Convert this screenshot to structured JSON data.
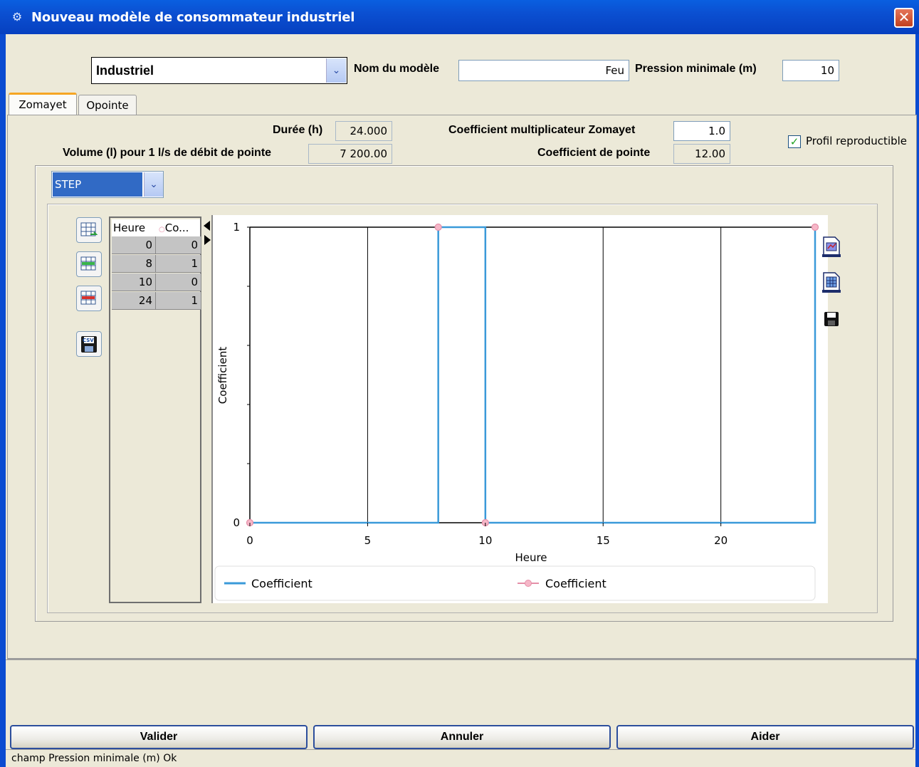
{
  "window": {
    "title": "Nouveau modèle de consommateur industriel",
    "close_label": "✕"
  },
  "header": {
    "type_selected": "Industriel",
    "model_name_label": "Nom du modèle",
    "model_name_value": "Feu",
    "min_pressure_label": "Pression minimale (m)",
    "min_pressure_value": "10"
  },
  "tabs": [
    {
      "label": "Zomayet",
      "active": true
    },
    {
      "label": "Opointe",
      "active": false
    }
  ],
  "params": {
    "duration_label": "Durée (h)",
    "duration_value": "24.000",
    "volume_label": "Volume (l) pour 1 l/s de débit de pointe",
    "volume_value": "7 200.00",
    "multiplier_label": "Coefficient multiplicateur Zomayet",
    "multiplier_value": "1.0",
    "peak_coef_label": "Coefficient de pointe",
    "peak_coef_value": "12.00",
    "reproducible_label": "Profil reproductible",
    "reproducible_checked": true
  },
  "curve_type": "STEP",
  "table": {
    "headers": [
      "Heure",
      "Co..."
    ],
    "rows": [
      [
        "0",
        "0"
      ],
      [
        "8",
        "1"
      ],
      [
        "10",
        "0"
      ],
      [
        "24",
        "1"
      ]
    ]
  },
  "chart_data": {
    "type": "line",
    "step": true,
    "xlabel": "Heure",
    "ylabel": "Coefficient",
    "xlim": [
      0,
      24
    ],
    "ylim": [
      0,
      1
    ],
    "x_ticks": [
      "0",
      "5",
      "10",
      "15",
      "20"
    ],
    "x_tick_values": [
      0,
      5,
      10,
      15,
      20
    ],
    "y_ticks": [
      "0",
      "1"
    ],
    "y_tick_values": [
      0,
      1
    ],
    "series": [
      {
        "name": "Coefficient",
        "x": [
          0,
          8,
          10,
          24
        ],
        "y": [
          0,
          1,
          0,
          1
        ],
        "color": "#3a9ad9",
        "style": "step-line"
      },
      {
        "name": "Coefficient",
        "x": [
          0,
          8,
          10,
          24
        ],
        "y": [
          0,
          1,
          0,
          1
        ],
        "color": "#e58fa8",
        "style": "markers"
      }
    ],
    "legend_position": "bottom"
  },
  "buttons": {
    "validate": "Valider",
    "cancel": "Annuler",
    "help": "Aider"
  },
  "status": "champ Pression minimale (m) Ok",
  "colors": {
    "titlebar": "#0a5fe0",
    "selection": "#316ac5",
    "step_line": "#3a9ad9",
    "marker": "#e58fa8"
  }
}
